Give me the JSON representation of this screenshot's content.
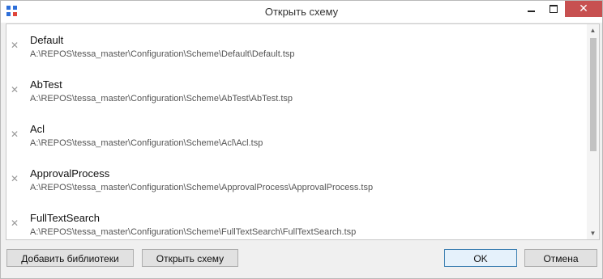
{
  "window": {
    "title": "Открыть схему",
    "close_glyph": "✕"
  },
  "list": {
    "items": [
      {
        "name": "Default",
        "path": "A:\\REPOS\\tessa_master\\Configuration\\Scheme\\Default\\Default.tsp"
      },
      {
        "name": "AbTest",
        "path": "A:\\REPOS\\tessa_master\\Configuration\\Scheme\\AbTest\\AbTest.tsp"
      },
      {
        "name": "Acl",
        "path": "A:\\REPOS\\tessa_master\\Configuration\\Scheme\\Acl\\Acl.tsp"
      },
      {
        "name": "ApprovalProcess",
        "path": "A:\\REPOS\\tessa_master\\Configuration\\Scheme\\ApprovalProcess\\ApprovalProcess.tsp"
      },
      {
        "name": "FullTextSearch",
        "path": "A:\\REPOS\\tessa_master\\Configuration\\Scheme\\FullTextSearch\\FullTextSearch.tsp"
      }
    ],
    "remove_glyph": "✕",
    "scroll_up_glyph": "▲",
    "scroll_down_glyph": "▼"
  },
  "buttons": {
    "add_libraries": "Добавить библиотеки",
    "open_scheme": "Открыть схему",
    "ok": "OK",
    "cancel": "Отмена"
  },
  "colors": {
    "close_button": "#c75050",
    "app_icon": "#2e6fd9",
    "default_button_border": "#3c7fb1"
  },
  "icons": {
    "app": "app-icon",
    "remove": "remove-icon"
  }
}
